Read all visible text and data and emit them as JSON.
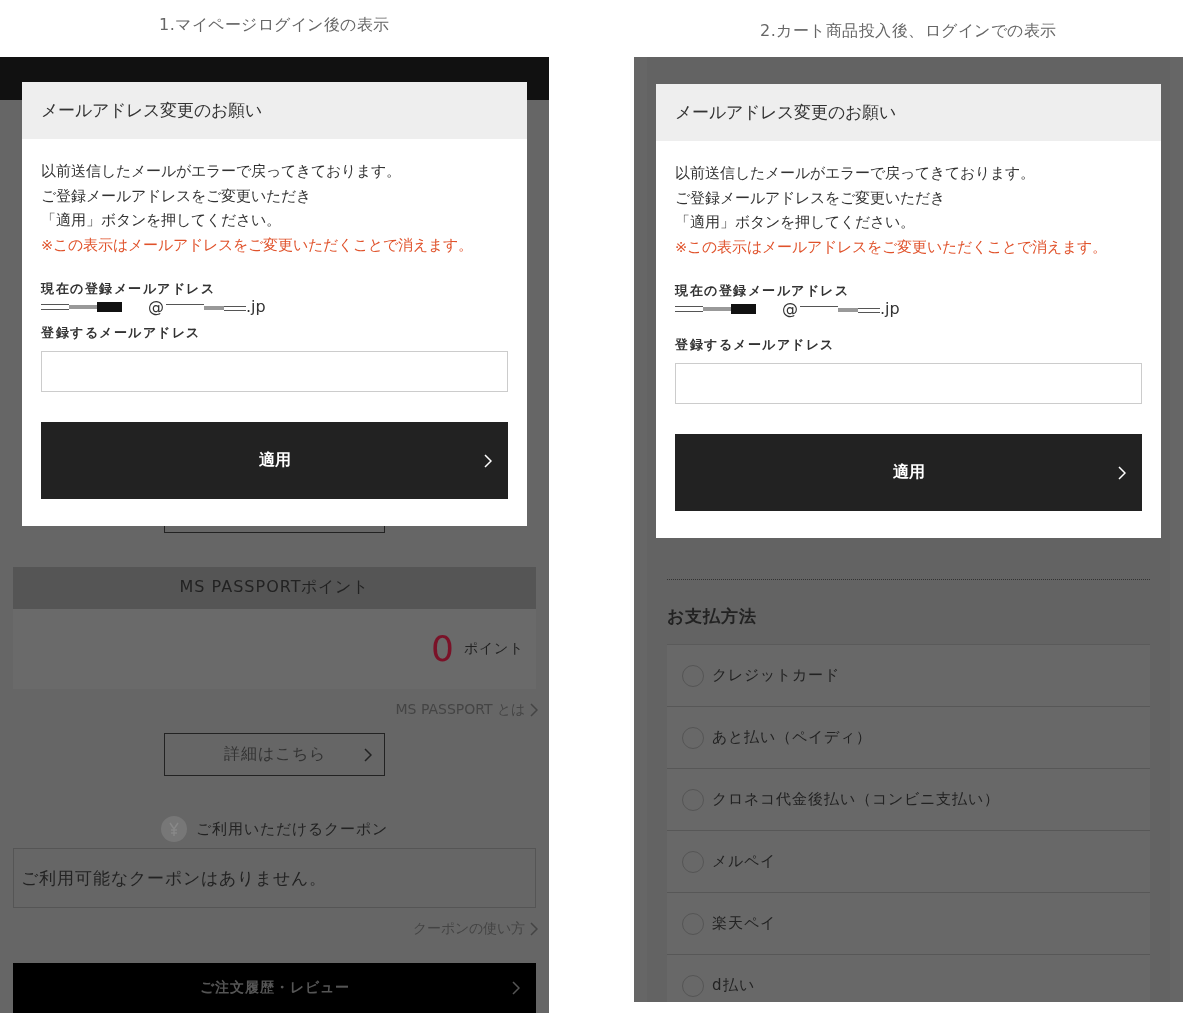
{
  "panels": [
    {
      "kind": "mypage",
      "caption": "1.マイページログイン後の表示",
      "modal": {
        "title": "メールアドレス変更のお願い",
        "lines": [
          "以前送信したメールがエラーで戻ってきております。",
          "ご登録メールアドレスをご変更いただき",
          "「適用」ボタンを押してください。"
        ],
        "notice": "※この表示はメールアドレスをご変更いただくことで消えます。",
        "current_label": "現在の登録メールアドレス",
        "email_separator": "@",
        "email_ending": ".jp",
        "new_label": "登録するメールアドレス",
        "apply_button": "適用"
      },
      "points": {
        "title": "MS PASSPORTポイント",
        "value": "0",
        "unit": "ポイント",
        "link": "MS PASSPORT とは",
        "button": "詳細はこちら"
      },
      "coupons": {
        "title": "ご利用いただけるクーポン",
        "message": "ご利用可能なクーポンはありません。",
        "link": "クーポンの使い方"
      },
      "order_history_button": "ご注文履歴・レビュー"
    },
    {
      "kind": "checkout",
      "caption": "2.カート商品投入後、ログインでの表示",
      "modal": {
        "title": "メールアドレス変更のお願い",
        "lines": [
          "以前送信したメールがエラーで戻ってきております。",
          "ご登録メールアドレスをご変更いただき",
          "「適用」ボタンを押してください。"
        ],
        "notice": "※この表示はメールアドレスをご変更いただくことで消えます。",
        "current_label": "現在の登録メールアドレス",
        "email_separator": "@",
        "email_ending": ".jp",
        "new_label": "登録するメールアドレス",
        "apply_button": "適用"
      },
      "payment": {
        "title": "お支払方法",
        "options": [
          {
            "label": "クレジットカード",
            "selected": false
          },
          {
            "label": "あと払い（ペイディ）",
            "selected": false
          },
          {
            "label": "クロネコ代金後払い（コンビニ支払い）",
            "selected": false
          },
          {
            "label": "メルペイ",
            "selected": false
          },
          {
            "label": "楽天ペイ",
            "selected": false
          },
          {
            "label": "d払い",
            "selected": false
          }
        ]
      }
    }
  ]
}
